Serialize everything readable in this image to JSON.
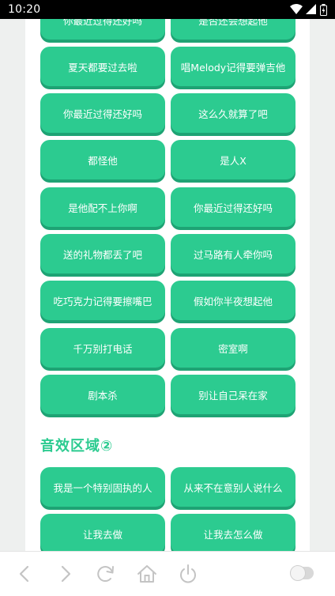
{
  "status_bar": {
    "time": "10:20"
  },
  "buttons": [
    {
      "label": "你最近过得还好吗"
    },
    {
      "label": "是否还会想起他"
    },
    {
      "label": "夏天都要过去啦"
    },
    {
      "label": "唱Melody记得要弹吉他"
    },
    {
      "label": "你最近过得还好吗"
    },
    {
      "label": "这么久就算了吧"
    },
    {
      "label": "都怪他"
    },
    {
      "label": "是人X"
    },
    {
      "label": "是他配不上你啊"
    },
    {
      "label": "你最近过得还好吗"
    },
    {
      "label": "送的礼物都丢了吧"
    },
    {
      "label": "过马路有人牵你吗"
    },
    {
      "label": "吃巧克力记得要擦嘴巴"
    },
    {
      "label": "假如你半夜想起他"
    },
    {
      "label": "千万别打电话"
    },
    {
      "label": "密室啊"
    },
    {
      "label": "剧本杀"
    },
    {
      "label": "别让自己呆在家"
    }
  ],
  "section2": {
    "title": "音效区域②",
    "buttons": [
      {
        "label": "我是一个特别固执的人"
      },
      {
        "label": "从来不在意别人说什么"
      },
      {
        "label": "让我去做"
      },
      {
        "label": "让我去怎么做"
      }
    ]
  },
  "colors": {
    "accent": "#2ccb90",
    "accent_shadow": "#1ea374",
    "icon_gray": "#c4c4c4"
  },
  "bottom_nav": {
    "icons": [
      "back-icon",
      "forward-icon",
      "refresh-icon",
      "home-icon",
      "power-icon"
    ],
    "toggle_on": false
  }
}
